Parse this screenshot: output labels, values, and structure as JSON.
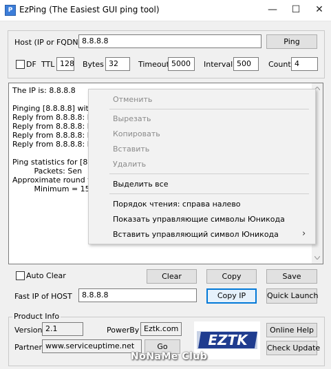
{
  "window": {
    "title": "EzPing (The Easiest GUI ping tool)",
    "app_icon": "P",
    "controls": [
      "—",
      "☐",
      "✕"
    ]
  },
  "host": {
    "label": "Host (IP or FQDN)",
    "value": "8.8.8.8",
    "ping_label": "Ping"
  },
  "options": {
    "df_label": "DF",
    "df_checked": false,
    "ttl_label": "TTL",
    "ttl_value": "128",
    "bytes_label": "Bytes",
    "bytes_value": "32",
    "timeout_label": "Timeout",
    "timeout_value": "5000",
    "interval_label": "Interval",
    "interval_value": "500",
    "count_label": "Count",
    "count_value": "4"
  },
  "output": {
    "lines": [
      "The IP is: 8.8.8.8",
      "",
      "Pinging [8.8.8.8] with 3",
      "Reply from 8.8.8.8: by",
      "Reply from 8.8.8.8: by",
      "Reply from 8.8.8.8: by",
      "Reply from 8.8.8.8: by",
      "",
      "Ping statistics for [8.8.",
      "         Packets: Sen",
      "Approximate round trip",
      "         Minimum = 15"
    ]
  },
  "context_menu": {
    "items": [
      {
        "label": "Отменить",
        "disabled": true
      },
      {
        "label": "Вырезать",
        "disabled": true
      },
      {
        "label": "Копировать",
        "disabled": true
      },
      {
        "label": "Вставить",
        "disabled": true
      },
      {
        "label": "Удалить",
        "disabled": true
      },
      {
        "label": "Выделить все",
        "disabled": false
      },
      {
        "label": "Порядок чтения: справа налево",
        "disabled": false
      },
      {
        "label": "Показать управляющие символы Юникода",
        "disabled": false
      },
      {
        "label": "Вставить управляющий символ Юникода",
        "disabled": false,
        "submenu_arrow": "›"
      }
    ]
  },
  "actions": {
    "auto_clear_label": "Auto Clear",
    "auto_clear_checked": false,
    "clear_label": "Clear",
    "copy_label": "Copy",
    "save_label": "Save"
  },
  "fast_ip": {
    "label": "Fast IP of HOST",
    "value": "8.8.8.8",
    "copy_ip_label": "Copy IP",
    "quick_launch_label": "Quick Launch"
  },
  "product_info": {
    "group_label": "Product Info",
    "version_label": "Version",
    "version_value": "2.1",
    "powerby_label": "PowerBy",
    "powerby_value": "Eztk.com",
    "partner_label": "Partner",
    "partner_value": "www.serviceuptime.net",
    "go_label": "Go",
    "online_help_label": "Online Help",
    "check_update_label": "Check Update",
    "logo_text": "EZTK"
  },
  "watermark": "NoNaMe Club",
  "colors": {
    "accent": "#0078d7",
    "logo_blue": "#1f3c8f"
  }
}
